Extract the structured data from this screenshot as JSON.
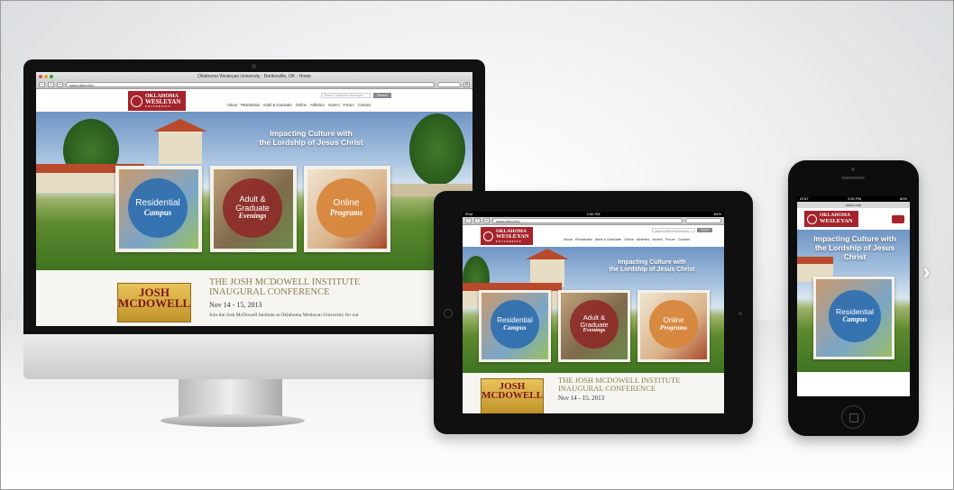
{
  "browser": {
    "window_title": "Oklahoma Wesleyan University - Bartlesville, OK - Home",
    "url": "www.okwu.edu"
  },
  "site": {
    "logo_line1": "OKLAHOMA",
    "logo_line2": "WESLEYAN",
    "logo_line3": "UNIVERSITY",
    "search_placeholder": "Search Oklahoma Wesleyan",
    "search_button": "Search",
    "nav": [
      "About",
      "Residential",
      "Adult & Graduate",
      "Online",
      "Athletics",
      "Alumni",
      "Forum",
      "Contact"
    ],
    "tagline_line1": "Impacting Culture with",
    "tagline_line2": "the Lordship of Jesus Christ",
    "tiles": [
      {
        "line1": "Residential",
        "line2": "Campus",
        "color": "#2f6fb0"
      },
      {
        "line1": "Adult &",
        "line1b": "Graduate",
        "line2": "Evenings",
        "color": "#8e2a28"
      },
      {
        "line1": "Online",
        "line2": "Programs",
        "color": "#d7843a"
      }
    ],
    "news": {
      "thumb_line1": "JOSH",
      "thumb_line2": "MCDOWELL",
      "title_line1": "THE JOSH MCDOWELL INSTITUTE",
      "title_line2": "INAUGURAL CONFERENCE",
      "date": "Nov 14 - 15, 2013",
      "body": "Join the Josh McDowell Institute at Oklahoma Wesleyan University for our"
    }
  },
  "ipad_status": {
    "carrier": "iPad",
    "time": "3:50 PM",
    "battery": "84%"
  },
  "iphone_status": {
    "carrier": "AT&T",
    "time": "3:50 PM",
    "battery": "60%",
    "url": "okwu.edu"
  },
  "iphone_tagline": [
    "Impacting Culture with",
    "the Lordship of Jesus",
    "Christ"
  ],
  "carousel": {
    "prev": "‹",
    "next": "›"
  }
}
